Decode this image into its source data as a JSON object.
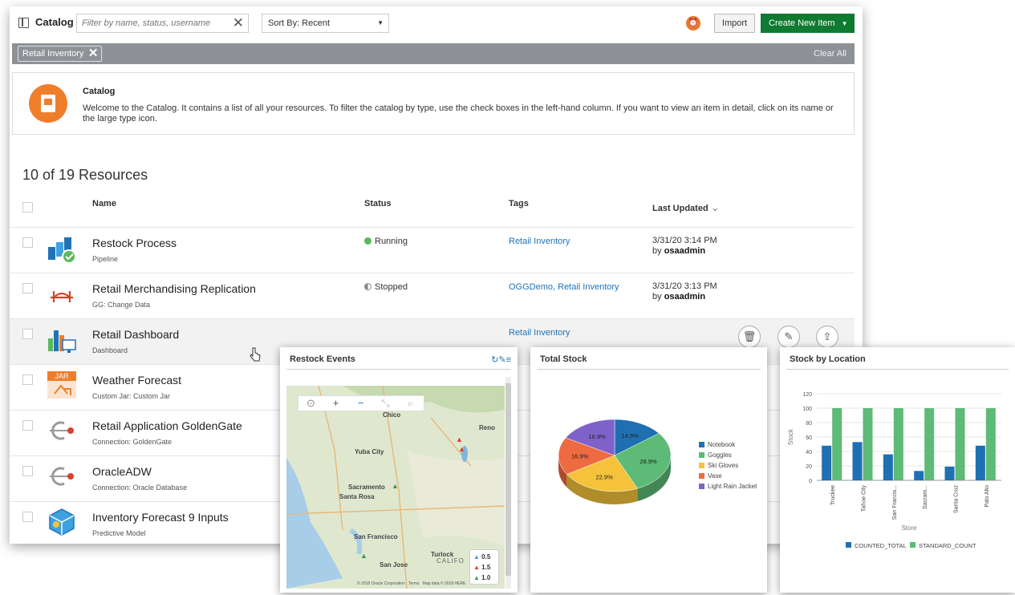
{
  "toolbar": {
    "title": "Catalog",
    "filter_placeholder": "Filter by name, status, username",
    "sort_label": "Sort By: Recent",
    "import_label": "Import",
    "create_label": "Create New Item"
  },
  "filter_bar": {
    "chip": "Retail Inventory",
    "clear_all": "Clear All"
  },
  "info": {
    "title": "Catalog",
    "text": "Welcome to the Catalog. It contains a list of all your resources. To filter the catalog by type, use the check boxes in the left-hand column. If you want to view an item in detail, click on its name or the large type icon."
  },
  "count": "10 of 19 Resources",
  "headers": {
    "name": "Name",
    "status": "Status",
    "tags": "Tags",
    "updated": "Last Updated"
  },
  "rows": [
    {
      "name": "Restock Process",
      "type": "Pipeline",
      "status": "Running",
      "tags": "Retail Inventory",
      "date": "3/31/20 3:14 PM",
      "by": "by ",
      "user": "osaadmin"
    },
    {
      "name": "Retail Merchandising Replication",
      "type": "GG: Change Data",
      "status": "Stopped",
      "tags": "OGGDemo, Retail Inventory",
      "date": "3/31/20 3:13 PM",
      "by": "by ",
      "user": "osaadmin"
    },
    {
      "name": "Retail Dashboard",
      "type": "Dashboard",
      "tags": "Retail Inventory"
    },
    {
      "name": "Weather Forecast",
      "type": "Custom Jar: Custom Jar"
    },
    {
      "name": "Retail Application GoldenGate",
      "type": "Connection: GoldenGate"
    },
    {
      "name": "OracleADW",
      "type": "Connection: Oracle Database"
    },
    {
      "name": "Inventory Forecast 9 Inputs",
      "type": "Predictive Model"
    }
  ],
  "jar_label": "JAR",
  "colors": {
    "green": "#0f7a31",
    "orange": "#ef7e2b",
    "link": "#1f73b7",
    "running": "#5cb85c"
  },
  "map_panel": {
    "title": "Restock Events",
    "cities": [
      "Chico",
      "Reno",
      "Yuba City",
      "Sacramento",
      "Santa Rosa",
      "San Francisco",
      "Turlock",
      "San Jose",
      "CALIFO"
    ],
    "legend": [
      "0.5",
      "1.5",
      "1.0"
    ],
    "footer": "© 2018 Oracle Corporation   Terms   Map data © 2018 HERE"
  },
  "pie_panel": {
    "title": "Total Stock"
  },
  "bar_panel": {
    "title": "Stock by Location"
  },
  "chart_data": [
    {
      "type": "pie",
      "title": "Total Stock",
      "categories": [
        "Notebook",
        "Goggles",
        "Ski Gloves",
        "Vase",
        "Light Rain Jacket"
      ],
      "values": [
        14.5,
        28.9,
        22.9,
        16.9,
        16.9
      ],
      "labels": [
        "14.5%",
        "28.9%",
        "22.9%",
        "16.9%",
        "16.9%"
      ],
      "colors": [
        "#1f6fb3",
        "#5dba77",
        "#f5c33b",
        "#ee6a41",
        "#7f62c9"
      ],
      "legend": "right"
    },
    {
      "type": "bar",
      "title": "Stock by Location",
      "categories": [
        "Truckee",
        "Tahoe City",
        "San Francis...",
        "Sacram...",
        "Santa Cruz",
        "Palo Alto"
      ],
      "series": [
        {
          "name": "COUNTED_TOTAL",
          "values": [
            48,
            53,
            36,
            13,
            19,
            48
          ],
          "color": "#1f6fb3"
        },
        {
          "name": "STANDARD_COUNT",
          "values": [
            100,
            100,
            100,
            100,
            100,
            100
          ],
          "color": "#5dba77"
        }
      ],
      "xlabel": "Store",
      "ylabel": "Stock",
      "ylim": [
        0,
        120
      ],
      "yticks": [
        "0",
        "20",
        "40",
        "60",
        "80",
        "100",
        "120"
      ],
      "legend": "bottom"
    }
  ]
}
